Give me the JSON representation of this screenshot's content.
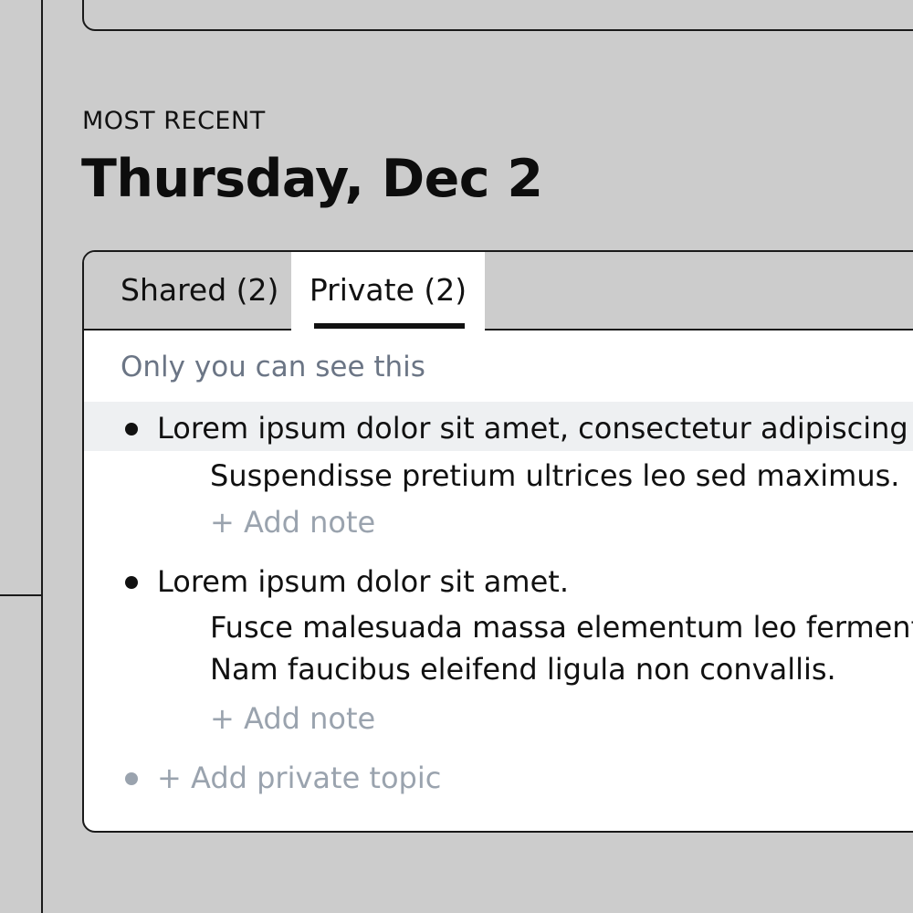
{
  "section": {
    "eyebrow": "MOST RECENT",
    "title": "Thursday, Dec 2"
  },
  "tabs": [
    {
      "label": "Shared (2)",
      "selected": false
    },
    {
      "label": "Private (2)",
      "selected": true
    }
  ],
  "private_panel": {
    "visibility_note": "Only you can see this",
    "topics": [
      {
        "title": "Lorem ipsum dolor sit amet, consectetur adipiscing e",
        "note_lines": [
          "Suspendisse pretium ultrices leo sed maximus."
        ],
        "add_note_label": "+ Add note",
        "highlighted": true
      },
      {
        "title": "Lorem ipsum dolor sit amet.",
        "note_lines": [
          "Fusce malesuada massa elementum leo ferment",
          "Nam faucibus eleifend ligula non convallis."
        ],
        "add_note_label": "+ Add note",
        "highlighted": false
      }
    ],
    "add_topic_label": "+ Add private topic"
  },
  "colors": {
    "background": "#cccccc",
    "card": "#ffffff",
    "muted_text": "#6b7585",
    "placeholder_text": "#9aa3ae",
    "highlight_row": "#eef0f2"
  }
}
